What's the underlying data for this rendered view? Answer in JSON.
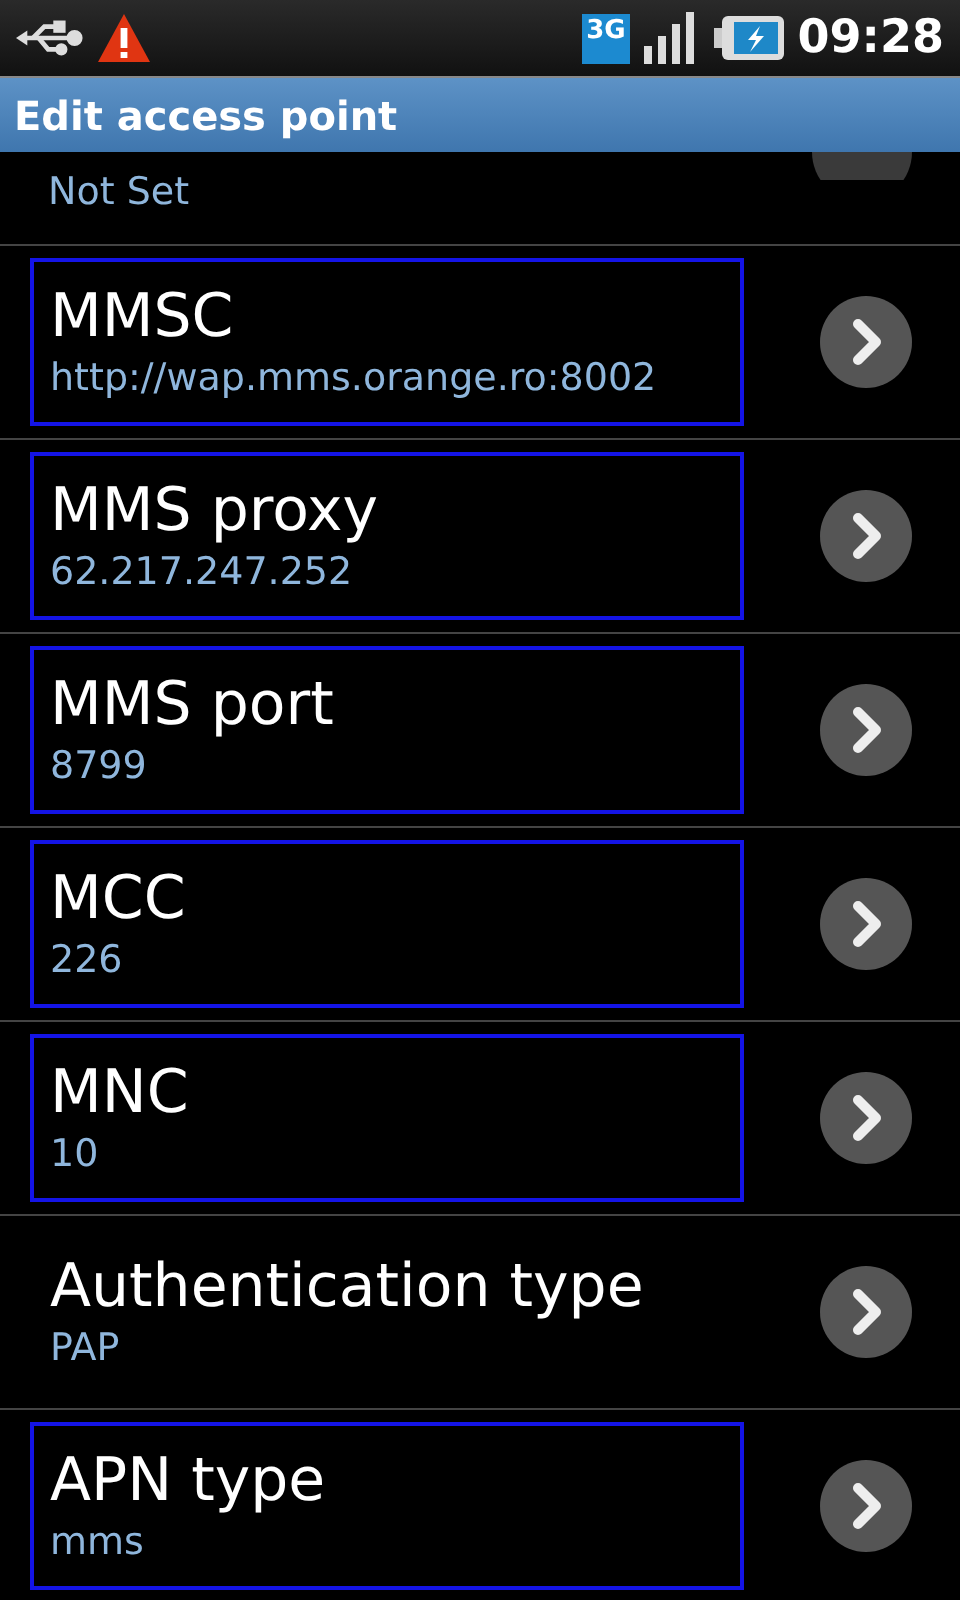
{
  "status_bar": {
    "time": "09:28",
    "network": "3G"
  },
  "title": "Edit access point",
  "partial_item": {
    "value": "Not Set"
  },
  "items": [
    {
      "title": "MMSC",
      "value": "http://wap.mms.orange.ro:8002",
      "outlined": true
    },
    {
      "title": "MMS proxy",
      "value": "62.217.247.252",
      "outlined": true
    },
    {
      "title": "MMS port",
      "value": "8799",
      "outlined": true
    },
    {
      "title": "MCC",
      "value": "226",
      "outlined": true
    },
    {
      "title": "MNC",
      "value": "10",
      "outlined": true
    },
    {
      "title": "Authentication type",
      "value": "PAP",
      "outlined": false
    },
    {
      "title": "APN type",
      "value": "mms",
      "outlined": true
    }
  ]
}
